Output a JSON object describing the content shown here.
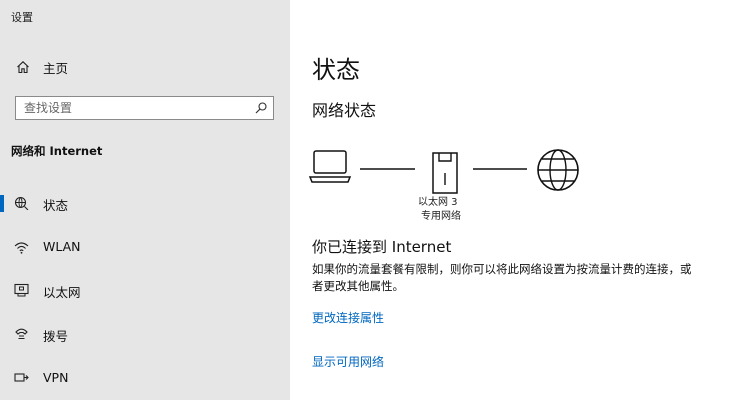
{
  "app_title": "设置",
  "sidebar": {
    "home_label": "主页",
    "search_placeholder": "查找设置",
    "section_title": "网络和 Internet",
    "items": [
      {
        "label": "状态",
        "icon": "status-icon",
        "selected": true
      },
      {
        "label": "WLAN",
        "icon": "wifi-icon",
        "selected": false
      },
      {
        "label": "以太网",
        "icon": "ethernet-icon",
        "selected": false
      },
      {
        "label": "拨号",
        "icon": "dialup-icon",
        "selected": false
      },
      {
        "label": "VPN",
        "icon": "vpn-icon",
        "selected": false
      }
    ]
  },
  "main": {
    "title": "状态",
    "subtitle": "网络状态",
    "diagram": {
      "adapter_name": "以太网 3",
      "network_type": "专用网络"
    },
    "connection_title": "你已连接到 Internet",
    "connection_desc": "如果你的流量套餐有限制，则你可以将此网络设置为按流量计费的连接，或者更改其他属性。",
    "links": {
      "change_properties": "更改连接属性",
      "show_networks": "显示可用网络"
    }
  },
  "colors": {
    "sidebar_bg": "#e6e6e6",
    "accent": "#0067c0"
  }
}
